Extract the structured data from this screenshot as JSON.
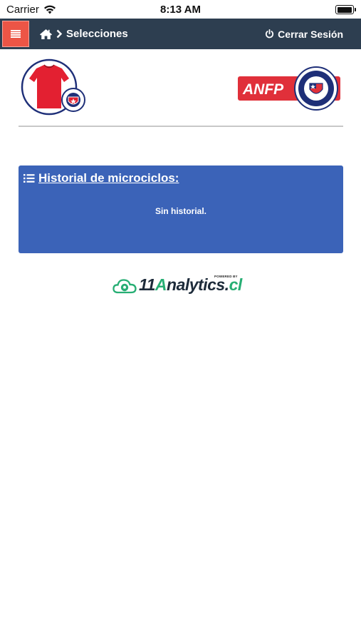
{
  "status_bar": {
    "carrier": "Carrier",
    "time": "8:13 AM"
  },
  "navbar": {
    "breadcrumb": {
      "current": "Selecciones"
    },
    "logout_label": "Cerrar Sesión"
  },
  "header": {
    "anfp_text": "ANFP"
  },
  "historial": {
    "title": "Historial de microciclos:",
    "empty_message": "Sin historial."
  },
  "footer": {
    "powered_by": "POWERED BY",
    "brand_prefix": "11",
    "brand_highlight": "A",
    "brand_middle": "nalytics.",
    "brand_suffix": "cl"
  },
  "colors": {
    "navbar_bg": "#2d3e50",
    "menu_button_bg": "#ec5546",
    "panel_bg": "#3b63b8",
    "anfp_red": "#e0303a",
    "brand_green": "#27ae74"
  }
}
